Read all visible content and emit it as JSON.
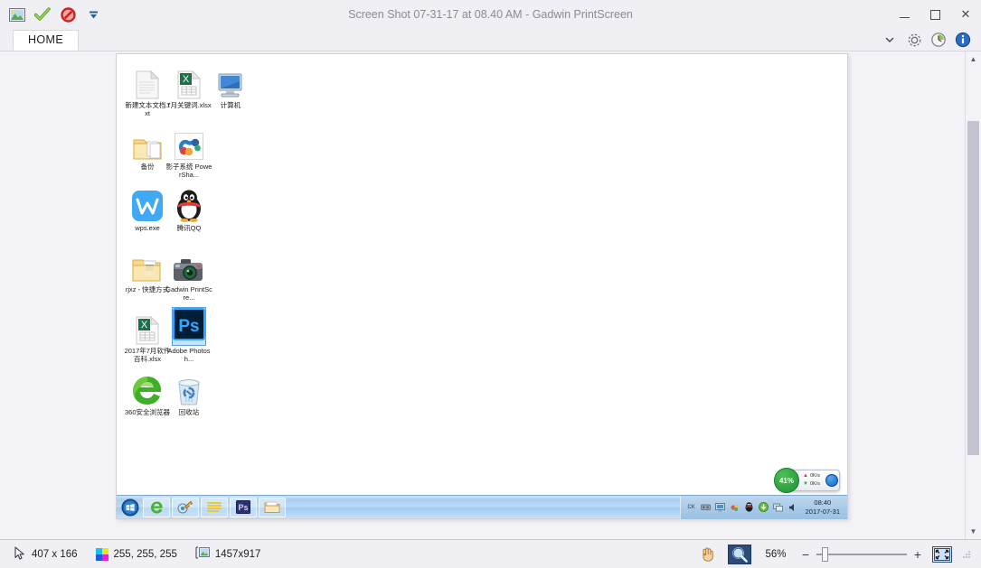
{
  "window": {
    "title": "Screen Shot 07-31-17 at 08.40 AM - Gadwin PrintScreen",
    "minimize_label": "Minimize",
    "maximize_label": "Maximize",
    "close_label": "✕"
  },
  "quick_access": {
    "items": [
      {
        "name": "image-icon",
        "tooltip": "Image"
      },
      {
        "name": "accept-icon",
        "tooltip": "Accept"
      },
      {
        "name": "cancel-icon",
        "tooltip": "Cancel"
      },
      {
        "name": "chevron-down-icon",
        "tooltip": "Customize Quick Access Toolbar"
      }
    ]
  },
  "ribbon": {
    "tabs": [
      {
        "label": "HOME",
        "active": true
      }
    ],
    "right_icons": [
      {
        "name": "chevron-down-icon",
        "tooltip": "Collapse the Ribbon"
      },
      {
        "name": "gear-icon",
        "tooltip": "Settings"
      },
      {
        "name": "history-icon",
        "tooltip": "History"
      },
      {
        "name": "info-icon",
        "tooltip": "About"
      }
    ]
  },
  "canvas": {
    "desktop_icons": [
      {
        "label": "新建文本文档.txt",
        "icon": "text-file-icon",
        "selected": false,
        "col": 0,
        "row": 0
      },
      {
        "label": "7月关键词.xlsx",
        "icon": "excel-file-icon",
        "selected": false,
        "col": 1,
        "row": 0
      },
      {
        "label": "计算机",
        "icon": "computer-icon",
        "selected": false,
        "col": 2,
        "row": 0
      },
      {
        "label": "备份",
        "icon": "folder-icon",
        "selected": false,
        "col": 0,
        "row": 1
      },
      {
        "label": "影子系统 PowerSha...",
        "icon": "shadow-system-icon",
        "selected": false,
        "col": 1,
        "row": 1
      },
      {
        "label": "wps.exe",
        "icon": "wps-icon",
        "selected": false,
        "col": 0,
        "row": 2
      },
      {
        "label": "腾讯QQ",
        "icon": "qq-penguin-icon",
        "selected": false,
        "col": 1,
        "row": 2
      },
      {
        "label": "rjxz - 快捷方式",
        "icon": "folder-shortcut-icon",
        "selected": false,
        "col": 0,
        "row": 3
      },
      {
        "label": "Gadwin PrintScre...",
        "icon": "camera-icon",
        "selected": false,
        "col": 1,
        "row": 3
      },
      {
        "label": "2017年7月软件百科.xlsx",
        "icon": "excel-file-icon",
        "selected": false,
        "col": 0,
        "row": 4
      },
      {
        "label": "Adobe Photosh...",
        "icon": "photoshop-icon",
        "selected": true,
        "col": 1,
        "row": 4
      },
      {
        "label": "360安全浏览器",
        "icon": "browser-e-icon",
        "selected": false,
        "col": 0,
        "row": 5
      },
      {
        "label": "回收站",
        "icon": "recycle-bin-icon",
        "selected": false,
        "col": 1,
        "row": 5
      }
    ],
    "taskbar": {
      "start_label": "start-orb-icon",
      "buttons": [
        {
          "name": "ie-browser-icon"
        },
        {
          "name": "media-player-icon"
        },
        {
          "name": "notes-icon"
        },
        {
          "name": "photoshop-taskbar-icon"
        },
        {
          "name": "explorer-icon"
        }
      ],
      "tray_icons": [
        {
          "name": "tray-ck-icon",
          "glyph": "CK"
        },
        {
          "name": "tray-speaker-icon",
          "glyph": ""
        },
        {
          "name": "tray-monitor-icon",
          "glyph": ""
        },
        {
          "name": "tray-shield-icon",
          "glyph": ""
        },
        {
          "name": "tray-qq-icon",
          "glyph": ""
        },
        {
          "name": "tray-download-icon",
          "glyph": ""
        },
        {
          "name": "tray-network-icon",
          "glyph": ""
        },
        {
          "name": "tray-volume-icon",
          "glyph": ""
        }
      ],
      "clock_time": "08:40",
      "clock_date": "2017-07-31"
    },
    "net_widget": {
      "percent": "41%",
      "upload_rate": "0K/s",
      "download_rate": "0K/s",
      "accent_color": "#1f8f38"
    }
  },
  "statusbar": {
    "cursor_position": "407 x 166",
    "color_value": "255, 255, 255",
    "image_size": "1457x917",
    "zoom_level": "56%",
    "zoom_out_label": "−",
    "zoom_in_label": "+",
    "tools": [
      {
        "name": "pan-hand-icon",
        "active": false
      },
      {
        "name": "magnifier-icon",
        "active": true
      }
    ],
    "fit_label": "fit-to-window-icon"
  }
}
